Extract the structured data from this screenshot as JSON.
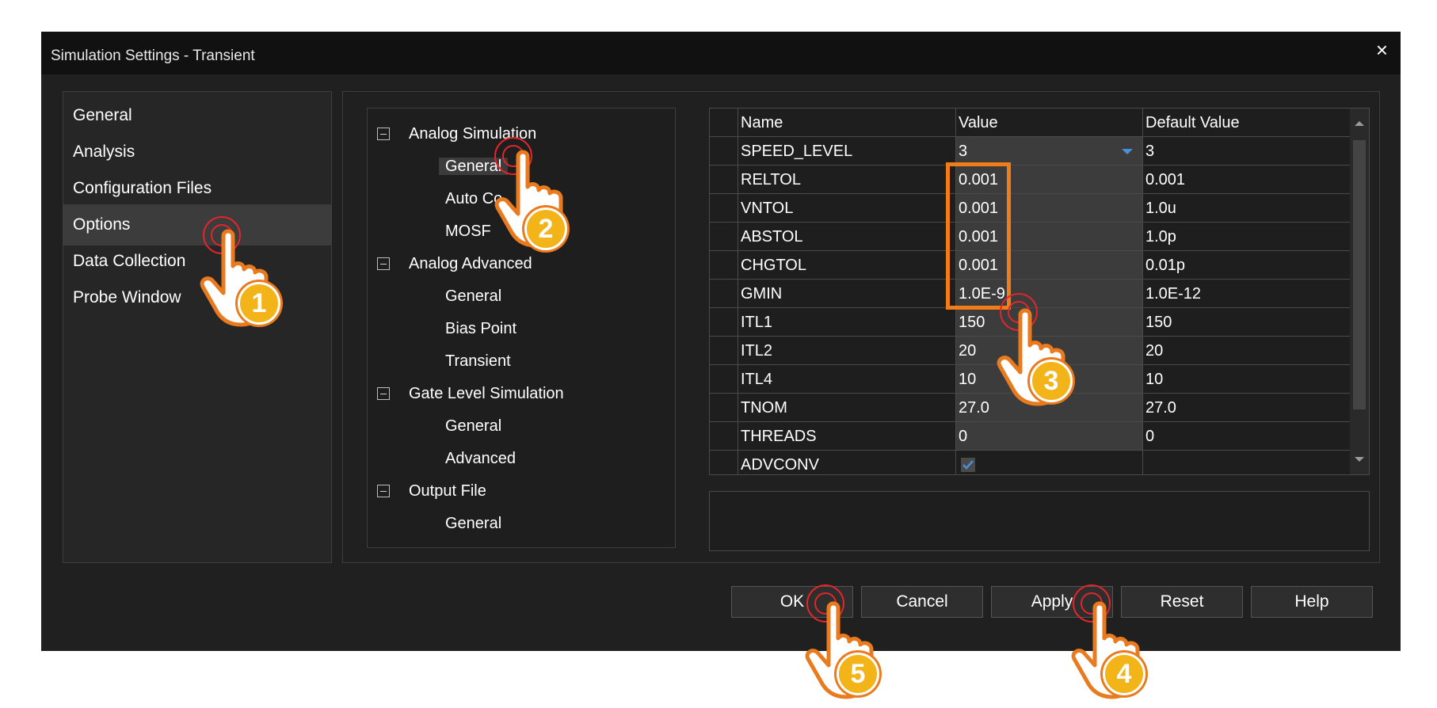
{
  "window": {
    "title": "Simulation Settings - Transient",
    "close_glyph": "×"
  },
  "nav": {
    "items": [
      {
        "label": "General",
        "selected": false
      },
      {
        "label": "Analysis",
        "selected": false
      },
      {
        "label": "Configuration Files",
        "selected": false
      },
      {
        "label": "Options",
        "selected": true
      },
      {
        "label": "Data Collection",
        "selected": false
      },
      {
        "label": "Probe Window",
        "selected": false
      }
    ]
  },
  "tree": {
    "groups": [
      {
        "label": "Analog Simulation",
        "children": [
          "General",
          "Auto Co",
          "MOSF"
        ]
      },
      {
        "label": "Analog Advanced",
        "children": [
          "General",
          "Bias Point",
          "Transient"
        ]
      },
      {
        "label": "Gate Level Simulation",
        "children": [
          "General",
          "Advanced"
        ]
      },
      {
        "label": "Output File",
        "children": [
          "General"
        ]
      }
    ],
    "selected_child": "General"
  },
  "grid": {
    "headers": {
      "name": "Name",
      "value": "Value",
      "default": "Default Value"
    },
    "rows": [
      {
        "name": "SPEED_LEVEL",
        "value": "3",
        "default": "3"
      },
      {
        "name": "RELTOL",
        "value": "0.001",
        "default": "0.001"
      },
      {
        "name": "VNTOL",
        "value": "0.001",
        "default": "1.0u"
      },
      {
        "name": "ABSTOL",
        "value": "0.001",
        "default": "1.0p"
      },
      {
        "name": "CHGTOL",
        "value": "0.001",
        "default": "0.01p"
      },
      {
        "name": "GMIN",
        "value": "1.0E-9",
        "default": "1.0E-12"
      },
      {
        "name": "ITL1",
        "value": "150",
        "default": "150"
      },
      {
        "name": "ITL2",
        "value": "20",
        "default": "20"
      },
      {
        "name": "ITL4",
        "value": "10",
        "default": "10"
      },
      {
        "name": "TNOM",
        "value": "27.0",
        "default": "27.0"
      },
      {
        "name": "THREADS",
        "value": "0",
        "default": "0"
      },
      {
        "name": "ADVCONV",
        "value": "",
        "default": ""
      }
    ]
  },
  "buttons": {
    "ok": "OK",
    "cancel": "Cancel",
    "apply": "Apply",
    "reset": "Reset",
    "help": "Help"
  },
  "annotations": {
    "step_numbers": [
      "1",
      "2",
      "3",
      "4",
      "5"
    ],
    "colors": {
      "ring": "#e0262b",
      "badge": "#f2b418",
      "hand_outline": "#e97a1e",
      "box": "#f07c1a"
    },
    "icon": "pointing-hand-icon"
  },
  "colors": {
    "dialog_bg": "#202020",
    "titlebar_bg": "#111111",
    "selected_bg": "#3c3c3c",
    "check_accent": "#4a8ed8"
  }
}
